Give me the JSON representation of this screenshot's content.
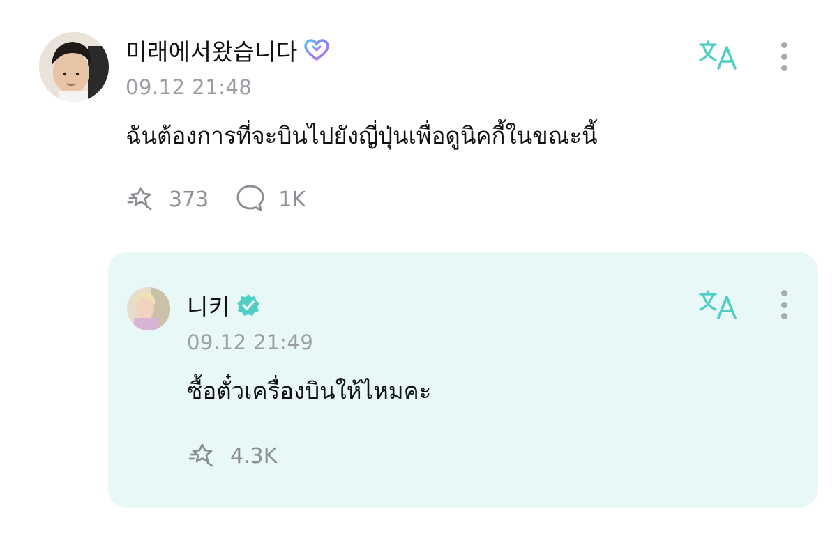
{
  "post": {
    "author": "미래에서왔습니다",
    "badge_icon": "heart-weverse-badge-icon",
    "timestamp": "09.12 21:48",
    "text": "ฉันต้องการที่จะบินไปยังญี่ปุ่นเพื่อดูนิคกี้ในขณะนี้",
    "like_count": "373",
    "comment_count": "1K",
    "translate_icon": "translate-icon",
    "more_icon": "more-vertical-icon"
  },
  "reply": {
    "author": "니키",
    "badge_icon": "verified-badge-icon",
    "timestamp": "09.12 21:49",
    "text": "ซื้อตั๋วเครื่องบินให้ไหมคะ",
    "like_count": "4.3K",
    "translate_icon": "translate-icon",
    "more_icon": "more-vertical-icon"
  },
  "colors": {
    "accent": "#4fcfc4",
    "reply_background": "#e8f8f6",
    "muted_text": "#9a9ea4",
    "heart_badge": "#7d8cf0"
  }
}
